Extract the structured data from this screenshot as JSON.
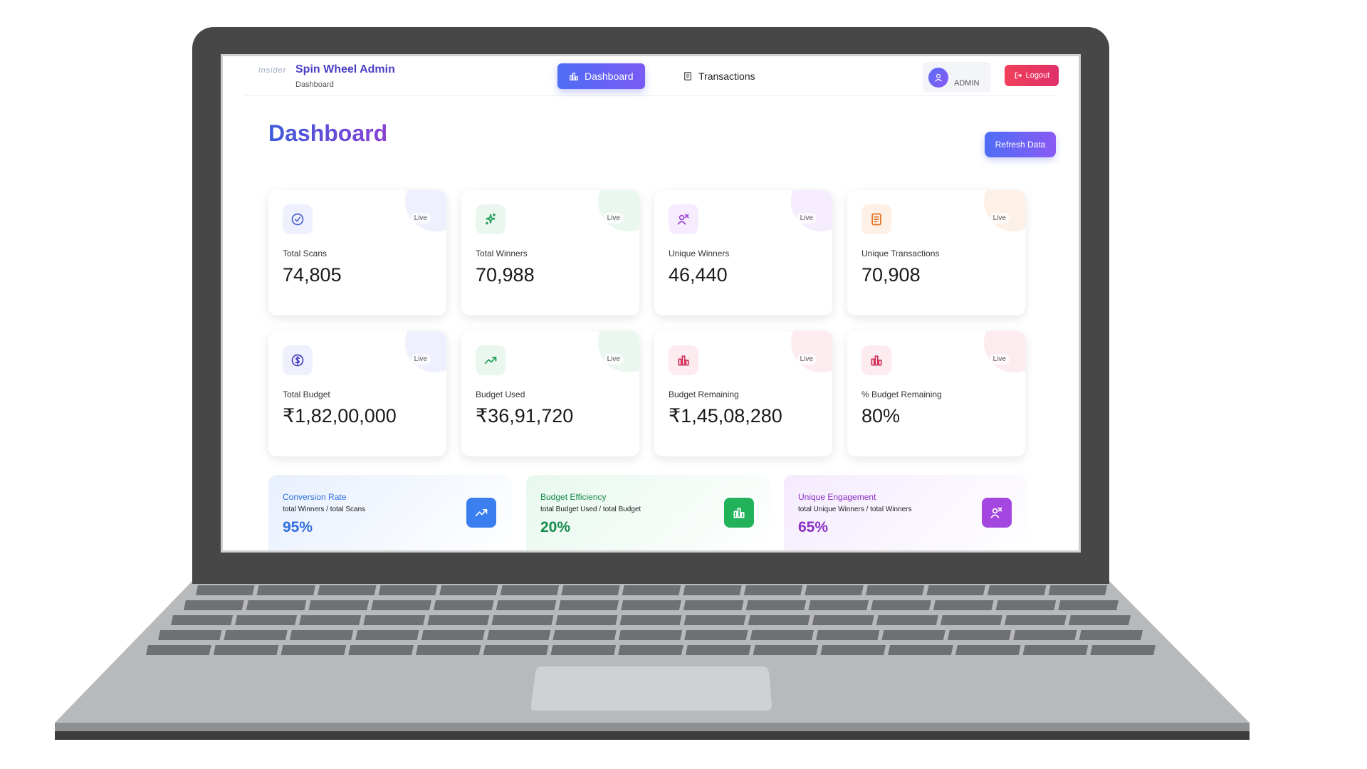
{
  "header": {
    "logo_text": "insider",
    "brand_title": "Spin Wheel Admin",
    "brand_subtitle": "Dashboard",
    "nav": [
      {
        "label": "Dashboard",
        "icon": "bar-chart-icon",
        "active": true
      },
      {
        "label": "Transactions",
        "icon": "receipt-icon",
        "active": false
      }
    ],
    "user_role": "ADMIN",
    "logout_label": "Logout"
  },
  "page": {
    "title": "Dashboard",
    "refresh_label": "Refresh Data"
  },
  "stat_cards": [
    {
      "label": "Total Scans",
      "value": "74,805",
      "badge": "Live",
      "icon": "check-circle-icon",
      "accent": "#4a5fd4",
      "tint": "#eef1fd"
    },
    {
      "label": "Total Winners",
      "value": "70,988",
      "badge": "Live",
      "icon": "sparkles-icon",
      "accent": "#1f9d55",
      "tint": "#e9f7ef"
    },
    {
      "label": "Unique Winners",
      "value": "46,440",
      "badge": "Live",
      "icon": "user-trophy-icon",
      "accent": "#9b3fd4",
      "tint": "#f5ecfd"
    },
    {
      "label": "Unique Transactions",
      "value": "70,908",
      "badge": "Live",
      "icon": "receipt-icon",
      "accent": "#e07020",
      "tint": "#fdf0e6"
    },
    {
      "label": "Total Budget",
      "value": "₹1,82,00,000",
      "badge": "Live",
      "icon": "dollar-circle-icon",
      "accent": "#4a3fc4",
      "tint": "#eef0fd"
    },
    {
      "label": "Budget Used",
      "value": "₹36,91,720",
      "badge": "Live",
      "icon": "trending-up-icon",
      "accent": "#1f9d55",
      "tint": "#e9f7ef"
    },
    {
      "label": "Budget Remaining",
      "value": "₹1,45,08,280",
      "badge": "Live",
      "icon": "bar-chart-icon",
      "accent": "#d4305a",
      "tint": "#fdecef"
    },
    {
      "label": "% Budget Remaining",
      "value": "80%",
      "badge": "Live",
      "icon": "bar-chart-icon",
      "accent": "#d4305a",
      "tint": "#fdecef"
    }
  ],
  "metrics": [
    {
      "title": "Conversion Rate",
      "formula": "total Winners / total Scans",
      "value": "95%",
      "icon": "trending-up-icon",
      "accent": "#2f6fe0",
      "bg": "#e8f0fd",
      "icon_bg": "#3b7ef0"
    },
    {
      "title": "Budget Efficiency",
      "formula": "total Budget Used / total Budget",
      "value": "20%",
      "icon": "bar-chart-icon",
      "accent": "#178a4a",
      "bg": "#e8f8ee",
      "icon_bg": "#22b35a"
    },
    {
      "title": "Unique Engagement",
      "formula": "total Unique Winners / total Winners",
      "value": "65%",
      "icon": "user-trophy-icon",
      "accent": "#8a2fc4",
      "bg": "#f4ebfd",
      "icon_bg": "#a447e0"
    }
  ]
}
